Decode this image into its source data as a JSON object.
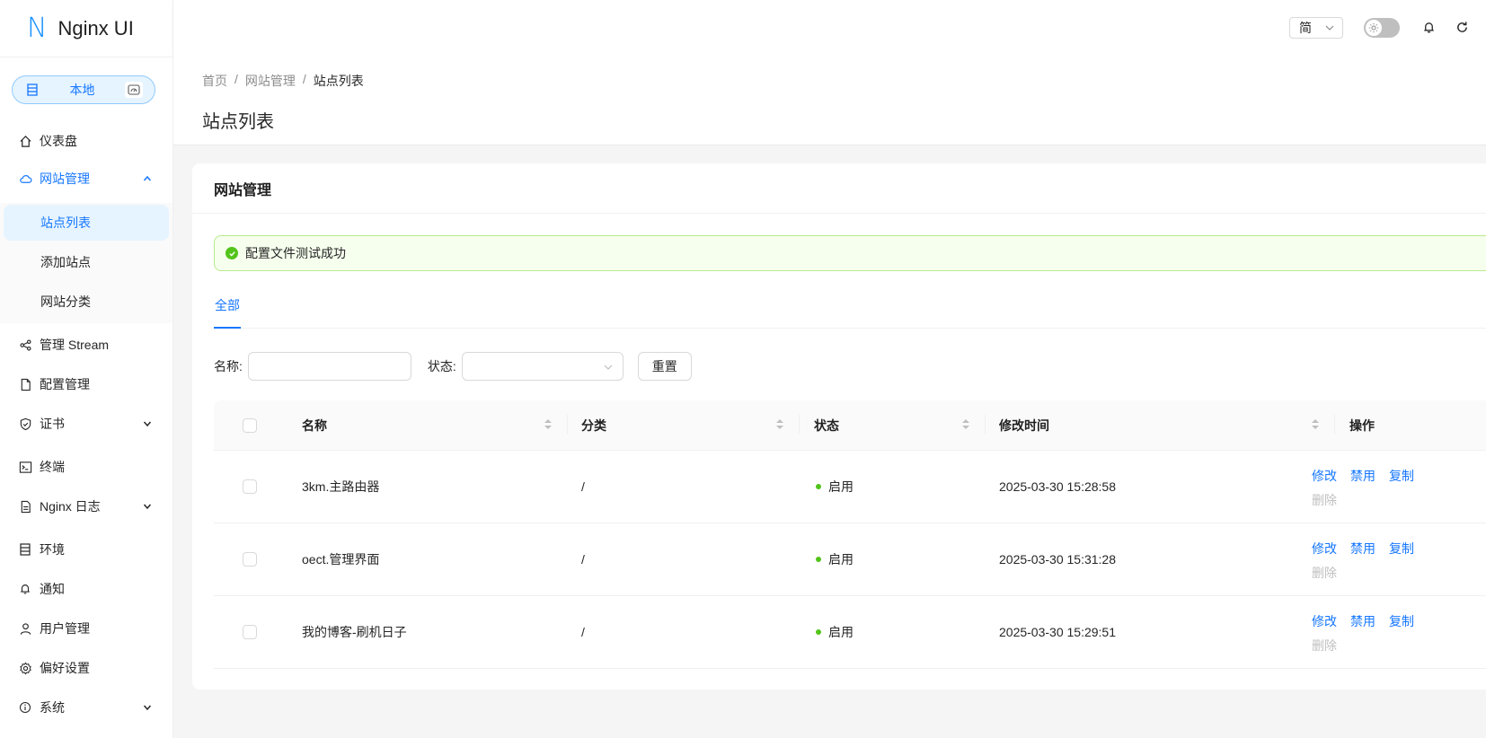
{
  "app": {
    "logo_mark": "N",
    "title": "Nginx UI"
  },
  "env": {
    "label": "本地"
  },
  "nav": {
    "dashboard": "仪表盘",
    "sites": "网站管理",
    "sites_sub": [
      "站点列表",
      "添加站点",
      "网站分类"
    ],
    "stream": "管理 Stream",
    "config": "配置管理",
    "cert": "证书",
    "terminal": "终端",
    "nginx_log": "Nginx 日志",
    "env": "环境",
    "notify": "通知",
    "users": "用户管理",
    "prefs": "偏好设置",
    "system": "系统"
  },
  "header": {
    "lang": "简"
  },
  "breadcrumb": [
    "首页",
    "网站管理",
    "站点列表"
  ],
  "breadcrumb_sep": "/",
  "page_title": "站点列表",
  "card_title": "网站管理",
  "alert": "配置文件测试成功",
  "tabs": [
    "全部"
  ],
  "filters": {
    "name_label": "名称:",
    "status_label": "状态:",
    "reset": "重置"
  },
  "table": {
    "columns": [
      "名称",
      "分类",
      "状态",
      "修改时间",
      "操作"
    ],
    "rows": [
      {
        "name": "3km.主路由器",
        "category": "/",
        "status": "启用",
        "modified": "2025-03-30 15:28:58"
      },
      {
        "name": "oect.管理界面",
        "category": "/",
        "status": "启用",
        "modified": "2025-03-30 15:31:28"
      },
      {
        "name": "我的博客-刷机日子",
        "category": "/",
        "status": "启用",
        "modified": "2025-03-30 15:29:51"
      }
    ],
    "actions": {
      "edit": "修改",
      "disable": "禁用",
      "copy": "复制",
      "delete": "删除"
    }
  },
  "colors": {
    "primary": "#1677ff",
    "success": "#52c41a"
  }
}
